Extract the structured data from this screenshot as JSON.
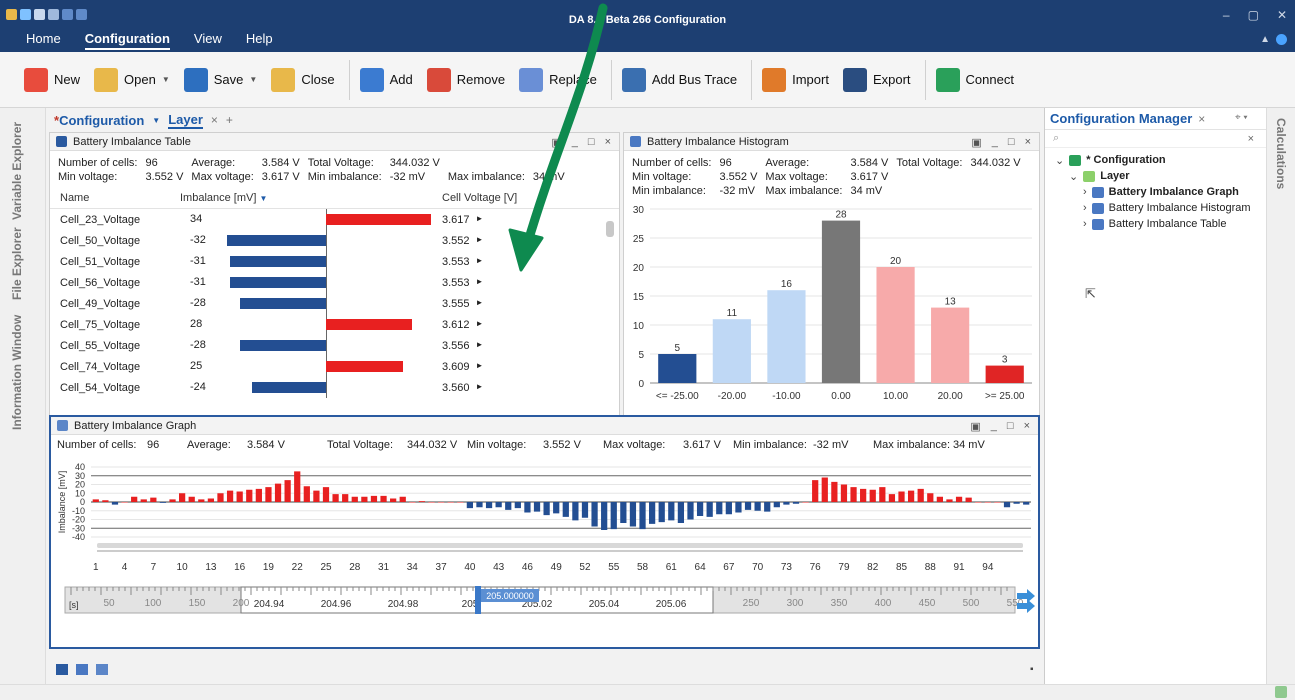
{
  "window": {
    "title": "DA 8.7 Beta 266 Configuration",
    "controls": [
      "–",
      "▢",
      "✕"
    ]
  },
  "menu": {
    "items": [
      "Home",
      "Configuration",
      "View",
      "Help"
    ],
    "active": 1
  },
  "toolbar": {
    "buttons": [
      {
        "label": "New",
        "icon": "new-icon",
        "color": "#e84c3d",
        "caret": false
      },
      {
        "label": "Open",
        "icon": "folder-icon",
        "color": "#e8b84a",
        "caret": true
      },
      {
        "label": "Save",
        "icon": "save-icon",
        "color": "#2d6fbf",
        "caret": true
      },
      {
        "label": "Close",
        "icon": "folder-close-icon",
        "color": "#e8b84a",
        "caret": false
      },
      {
        "label": "Add",
        "icon": "add-chart-icon",
        "color": "#3b7bd1",
        "caret": false
      },
      {
        "label": "Remove",
        "icon": "remove-chart-icon",
        "color": "#d94a3a",
        "caret": false
      },
      {
        "label": "Replace",
        "icon": "replace-chart-icon",
        "color": "#6a8fd6",
        "caret": false
      },
      {
        "label": "Add Bus Trace",
        "icon": "bus-trace-icon",
        "color": "#3a6fb0",
        "caret": false
      },
      {
        "label": "Import",
        "icon": "import-icon",
        "color": "#e07a2a",
        "caret": false
      },
      {
        "label": "Export",
        "icon": "export-icon",
        "color": "#2a4d80",
        "caret": false
      },
      {
        "label": "Connect",
        "icon": "connect-icon",
        "color": "#2aa05a",
        "caret": false
      }
    ]
  },
  "left_tabs": [
    "Variable Explorer",
    "File Explorer",
    "Information Window"
  ],
  "right_tab": "Calculations",
  "doc_tabs": {
    "config": "Configuration",
    "layer": "Layer",
    "add": "+"
  },
  "table_panel": {
    "title": "Battery Imbalance Table",
    "stats": [
      [
        "Number of cells:",
        "96",
        "Average:",
        "3.584 V",
        "Total Voltage:",
        "344.032 V"
      ],
      [
        "Min voltage:",
        "3.552 V",
        "Max voltage:",
        "3.617 V",
        "Min imbalance:",
        "-32 mV",
        "Max imbalance:",
        "34 mV"
      ]
    ],
    "columns": [
      "Name",
      "Imbalance [mV]",
      "Cell Voltage [V]"
    ],
    "rows": [
      {
        "name": "Cell_23_Voltage",
        "imb": 34,
        "v": "3.617"
      },
      {
        "name": "Cell_50_Voltage",
        "imb": -32,
        "v": "3.552"
      },
      {
        "name": "Cell_51_Voltage",
        "imb": -31,
        "v": "3.553"
      },
      {
        "name": "Cell_56_Voltage",
        "imb": -31,
        "v": "3.553"
      },
      {
        "name": "Cell_49_Voltage",
        "imb": -28,
        "v": "3.555"
      },
      {
        "name": "Cell_75_Voltage",
        "imb": 28,
        "v": "3.612"
      },
      {
        "name": "Cell_55_Voltage",
        "imb": -28,
        "v": "3.556"
      },
      {
        "name": "Cell_74_Voltage",
        "imb": 25,
        "v": "3.609"
      },
      {
        "name": "Cell_54_Voltage",
        "imb": -24,
        "v": "3.560"
      }
    ]
  },
  "histogram_panel": {
    "title": "Battery Imbalance Histogram",
    "stats": [
      [
        "Number of cells:",
        "96",
        "Average:",
        "3.584 V",
        "Total Voltage:",
        "344.032 V"
      ],
      [
        "Min voltage:",
        "3.552 V",
        "Max voltage:",
        "3.617 V"
      ],
      [
        "Min imbalance:",
        "-32 mV",
        "Max imbalance:",
        "34 mV"
      ]
    ]
  },
  "graph_panel": {
    "title": "Battery Imbalance Graph",
    "stats": [
      "Number of cells:",
      "96",
      "Average:",
      "3.584 V",
      "Total Voltage:",
      "344.032 V",
      "Min voltage:",
      "3.552 V",
      "Max voltage:",
      "3.617 V",
      "Min imbalance:",
      "-32 mV",
      "Max imbalance:",
      "34 mV"
    ],
    "ylabel": "Imbalance [mV]",
    "time_ticks": [
      "204.94",
      "204.96",
      "204.98",
      "205",
      "205.02",
      "205.04",
      "205.06"
    ],
    "time_outer_left": [
      "50",
      "100",
      "150",
      "200"
    ],
    "time_outer_right": [
      "250",
      "300",
      "350",
      "400",
      "450",
      "500",
      "550"
    ],
    "cursor": "205.000000",
    "unit": "[s]"
  },
  "config_manager": {
    "title": "Configuration Manager",
    "search_placeholder": "",
    "tree": [
      {
        "label": "* Configuration",
        "level": 0,
        "bold": true,
        "icon": "config-icon"
      },
      {
        "label": "Layer",
        "level": 1,
        "bold": true,
        "icon": "layer-folder-icon"
      },
      {
        "label": "Battery Imbalance Graph",
        "level": 2,
        "bold": true,
        "icon": "graph-icon"
      },
      {
        "label": "Battery Imbalance Histogram",
        "level": 2,
        "bold": false,
        "icon": "histogram-icon"
      },
      {
        "label": "Battery Imbalance Table",
        "level": 2,
        "bold": false,
        "icon": "table-icon"
      }
    ]
  },
  "chart_data": [
    {
      "type": "bar",
      "title": "Battery Imbalance Histogram",
      "categories": [
        "<= -25.00",
        "-20.00",
        "-10.00",
        "0.00",
        "10.00",
        "20.00",
        ">= 25.00"
      ],
      "values": [
        5,
        11,
        16,
        28,
        20,
        13,
        3
      ],
      "colors": [
        "#234e92",
        "#bfd8f5",
        "#bfd8f5",
        "#777777",
        "#f7aaaa",
        "#f7aaaa",
        "#e02525"
      ],
      "ylim": [
        0,
        30
      ],
      "yticks": [
        0,
        5,
        10,
        15,
        20,
        25,
        30
      ]
    },
    {
      "type": "bar",
      "title": "Battery Imbalance Graph",
      "ylabel": "Imbalance [mV]",
      "ylim": [
        -40,
        40
      ],
      "yticks": [
        40,
        30,
        20,
        10,
        0,
        -10,
        -20,
        -30,
        -40
      ],
      "xticks": [
        1,
        4,
        7,
        10,
        13,
        16,
        19,
        22,
        25,
        28,
        31,
        34,
        37,
        40,
        43,
        46,
        49,
        52,
        55,
        58,
        61,
        64,
        67,
        70,
        73,
        76,
        79,
        82,
        85,
        88,
        91,
        94
      ],
      "values": [
        3,
        2,
        -3,
        0,
        6,
        3,
        5,
        -1,
        3,
        10,
        6,
        3,
        4,
        10,
        13,
        12,
        14,
        15,
        17,
        21,
        25,
        35,
        18,
        13,
        17,
        9,
        9,
        6,
        6,
        7,
        7,
        4,
        6,
        0,
        1,
        0,
        0,
        0,
        0,
        -7,
        -6,
        -7,
        -6,
        -9,
        -7,
        -12,
        -11,
        -15,
        -13,
        -17,
        -21,
        -18,
        -28,
        -32,
        -31,
        -24,
        -28,
        -31,
        -25,
        -23,
        -21,
        -24,
        -20,
        -16,
        -17,
        -14,
        -14,
        -12,
        -9,
        -10,
        -11,
        -6,
        -3,
        -2,
        0,
        25,
        28,
        23,
        20,
        17,
        15,
        14,
        17,
        9,
        12,
        13,
        15,
        10,
        6,
        3,
        6,
        5,
        0,
        0,
        0,
        -6,
        -2,
        -3
      ]
    }
  ]
}
